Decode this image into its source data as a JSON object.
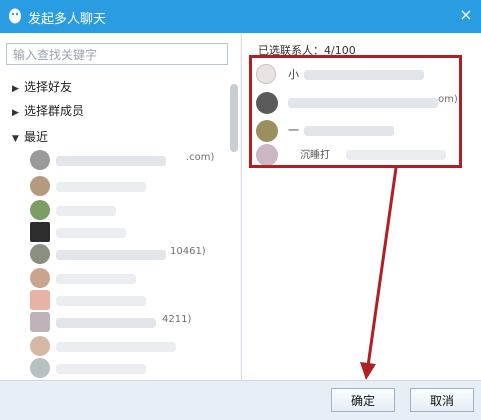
{
  "window": {
    "title": "发起多人聊天",
    "close_label": "×"
  },
  "left": {
    "search_placeholder": "输入查找关键字",
    "groups": [
      {
        "label": "选择好友",
        "expanded": false
      },
      {
        "label": "选择群成员",
        "expanded": false
      },
      {
        "label": "最近",
        "expanded": true
      }
    ],
    "recent_fragments": [
      ".com)",
      "10461)",
      "4211)"
    ]
  },
  "right": {
    "selected_label": "已选联系人：4/100",
    "selected_items": [
      {
        "name": "小",
        "suffix": ""
      },
      {
        "name": "",
        "suffix": "om)"
      },
      {
        "name": "一",
        "suffix": ""
      },
      {
        "name": "沉睡打",
        "suffix": ""
      }
    ]
  },
  "footer": {
    "ok_label": "确定",
    "cancel_label": "取消"
  },
  "annotation_color": "#b01f24",
  "titlebar_color": "#2a9ce2"
}
